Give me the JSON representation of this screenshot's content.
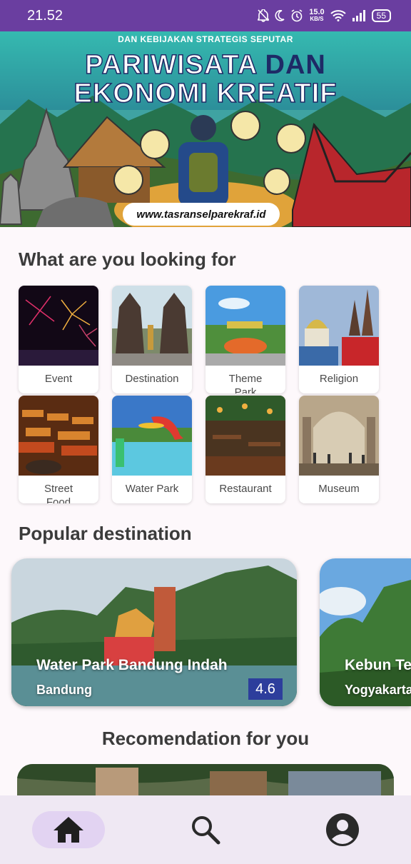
{
  "status_bar": {
    "time": "21.52",
    "net_speed_value": "15.0",
    "net_speed_unit": "KB/S",
    "battery": "55"
  },
  "banner": {
    "top_line": "DAN KEBIJAKAN STRATEGIS SEPUTAR",
    "title_line1_a": "PARIWISATA",
    "title_line1_b": "DAN",
    "title_line2": "EKONOMI KREATIF",
    "url": "www.tasranselparekraf.id"
  },
  "categories_section": {
    "title": "What are you looking for",
    "items": [
      {
        "label": "Event"
      },
      {
        "label": "Destination"
      },
      {
        "label": "Theme\nPark"
      },
      {
        "label": "Religion"
      },
      {
        "label": "Street\nFood"
      },
      {
        "label": "Water Park"
      },
      {
        "label": "Restaurant"
      },
      {
        "label": "Museum"
      }
    ]
  },
  "popular_section": {
    "title": "Popular destination",
    "items": [
      {
        "name": "Water Park Bandung Indah",
        "city": "Bandung",
        "rating": "4.6"
      },
      {
        "name": "Kebun Te",
        "city": "Yogyakarta"
      }
    ]
  },
  "recommendation_section": {
    "title": "Recomendation for you"
  },
  "bottom_nav": {
    "items": [
      {
        "icon": "home-icon",
        "active": true
      },
      {
        "icon": "search-icon",
        "active": false
      },
      {
        "icon": "account-icon",
        "active": false
      }
    ]
  },
  "colors": {
    "status_bar": "#6a3ea0",
    "rating_badge": "#2d3e9c",
    "nav_active_pill": "#e2d3f2",
    "nav_background": "#efe8f3"
  }
}
